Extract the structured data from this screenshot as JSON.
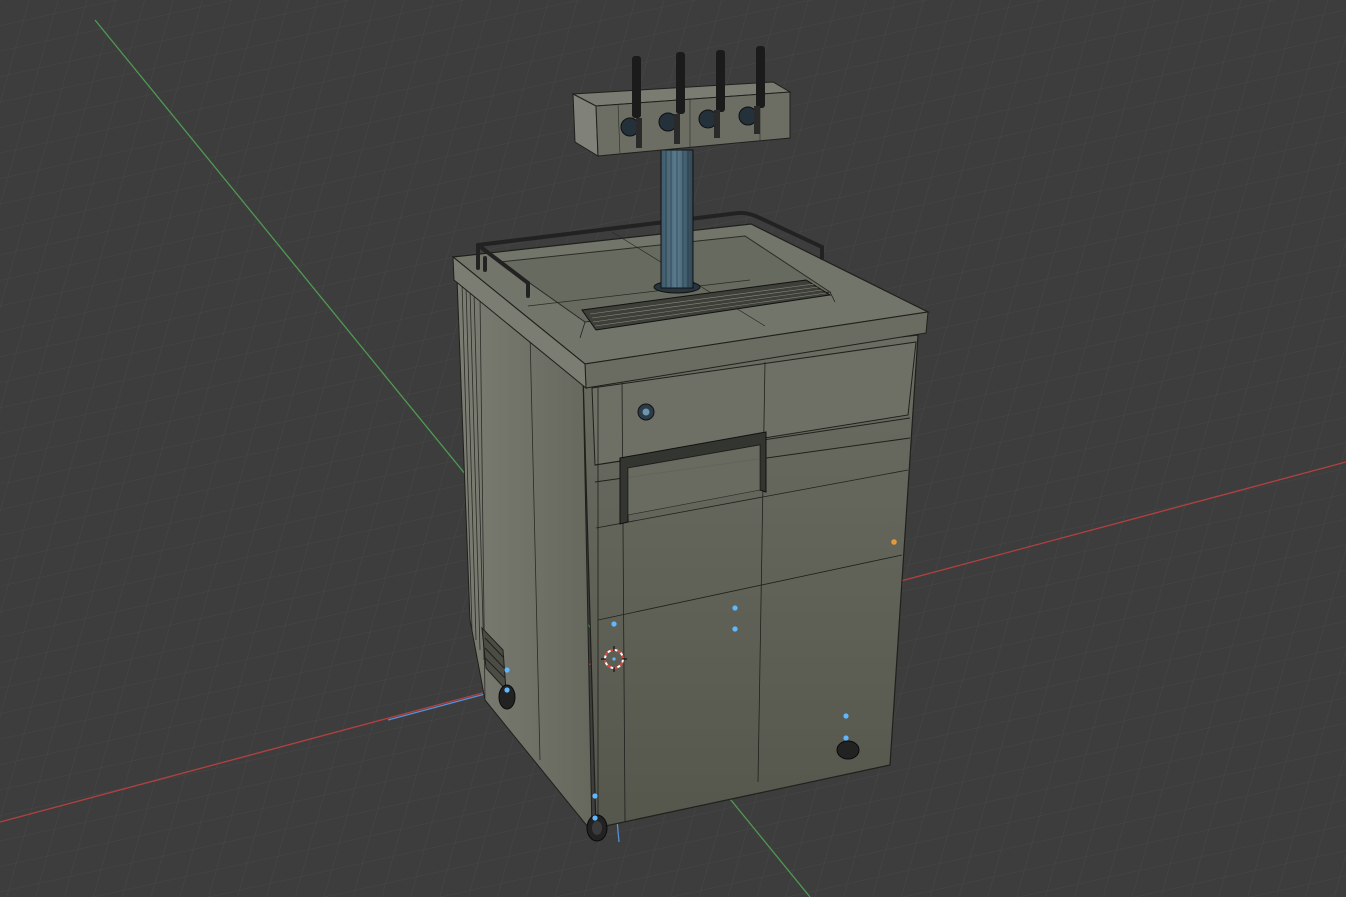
{
  "app": {
    "view": "3D viewport",
    "mode": "wireframe-overlay"
  },
  "scene": {
    "object": "keg-refrigerator-model",
    "tap_count": 4,
    "has_drip_tray": true,
    "has_guard_rail": true,
    "has_casters": true
  },
  "theme": {
    "background": "#3d3d3d",
    "grid_minor": "#474747",
    "grid_major": "#4e4e4e",
    "axis_x": "#b34040",
    "axis_y": "#4f9a52",
    "axis_z": "#5a8ed6",
    "model_front": "#5b5d52",
    "model_top": "#6d7064",
    "model_side": "#71736a",
    "wire": "#1f201c",
    "vertex_selected": "#5eb7ff",
    "vertex_active": "#e39a3a",
    "cursor_red": "#e0463f"
  }
}
